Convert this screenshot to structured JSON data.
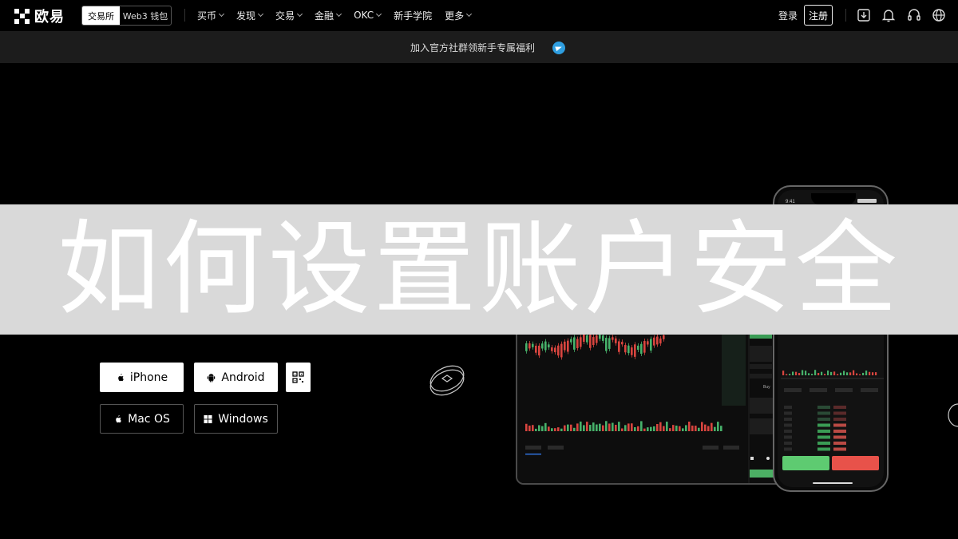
{
  "header": {
    "logo_text": "欧易",
    "segments": [
      "交易所",
      "Web3 钱包"
    ],
    "nav_items": [
      {
        "label": "买币",
        "dropdown": true
      },
      {
        "label": "发现",
        "dropdown": true
      },
      {
        "label": "交易",
        "dropdown": true
      },
      {
        "label": "金融",
        "dropdown": true
      },
      {
        "label": "OKC",
        "dropdown": true
      },
      {
        "label": "新手学院",
        "dropdown": false
      },
      {
        "label": "更多",
        "dropdown": true
      }
    ],
    "login_label": "登录",
    "register_label": "注册",
    "icons": [
      "download-icon",
      "bell-icon",
      "headset-icon",
      "globe-icon"
    ]
  },
  "banner": {
    "text": "加入官方社群领新手专属福利",
    "icon": "telegram-icon",
    "icon_color": "#2e9ee0"
  },
  "overlay": {
    "title": "如何设置账户安全",
    "band_color": "#d9d9d9"
  },
  "downloads": {
    "iphone": "iPhone",
    "android": "Android",
    "macos": "Mac OS",
    "windows": "Windows",
    "qr_icon": "qr-code-icon"
  },
  "phone": {
    "time": "9:41",
    "buy_color": "#5ecb71",
    "sell_color": "#e8524a"
  },
  "tablet": {
    "buy_label": "Buy"
  },
  "colors": {
    "up": "#47b26b",
    "down": "#d9453f",
    "background": "#000000"
  }
}
